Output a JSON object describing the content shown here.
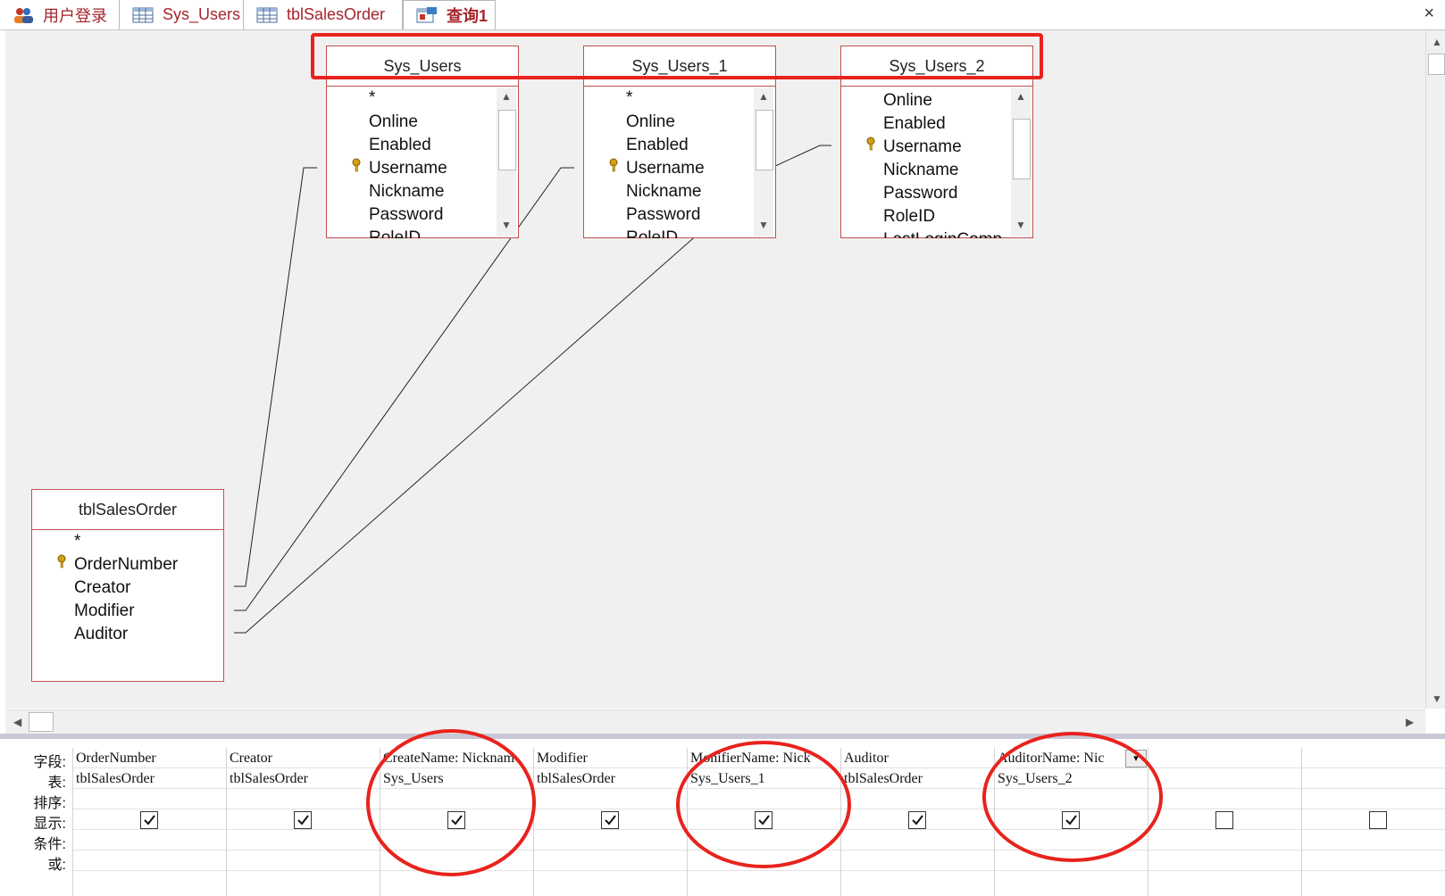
{
  "tabs": [
    {
      "label": "用户登录",
      "icon": "users-form-icon"
    },
    {
      "label": "Sys_Users",
      "icon": "table-icon"
    },
    {
      "label": "tblSalesOrder",
      "icon": "table-icon"
    },
    {
      "label": "查询1",
      "icon": "query-icon"
    }
  ],
  "close_label": "×",
  "tables": {
    "sys_users": {
      "title": "Sys_Users",
      "fields": [
        "*",
        "Online",
        "Enabled",
        "Username",
        "Nickname",
        "Password",
        "RoleID"
      ]
    },
    "sys_users_1": {
      "title": "Sys_Users_1",
      "fields": [
        "*",
        "Online",
        "Enabled",
        "Username",
        "Nickname",
        "Password",
        "RoleID"
      ]
    },
    "sys_users_2": {
      "title": "Sys_Users_2",
      "fields": [
        "Online",
        "Enabled",
        "Username",
        "Nickname",
        "Password",
        "RoleID",
        "LastLoginComp"
      ]
    },
    "sales": {
      "title": "tblSalesOrder",
      "fields": [
        "*",
        "OrderNumber",
        "Creator",
        "Modifier",
        "Auditor"
      ]
    }
  },
  "grid": {
    "row_labels": [
      "字段:",
      "表:",
      "排序:",
      "显示:",
      "条件:",
      "或:"
    ],
    "columns": [
      {
        "field": "OrderNumber",
        "table": "tblSalesOrder",
        "show": true
      },
      {
        "field": "Creator",
        "table": "tblSalesOrder",
        "show": true
      },
      {
        "field": "CreateName: Nicknam",
        "table": "Sys_Users",
        "show": true
      },
      {
        "field": "Modifier",
        "table": "tblSalesOrder",
        "show": true
      },
      {
        "field": "MonifierName: Nick",
        "table": "Sys_Users_1",
        "show": true
      },
      {
        "field": "Auditor",
        "table": "tblSalesOrder",
        "show": true
      },
      {
        "field": "AuditorName: Nic",
        "table": "Sys_Users_2",
        "show": true
      },
      {
        "field": "",
        "table": "",
        "show": false
      },
      {
        "field": "",
        "table": "",
        "show": false
      }
    ]
  },
  "colors": {
    "accent": "#a4262c",
    "annotation": "#e8231d",
    "table_border": "#c0504d"
  }
}
